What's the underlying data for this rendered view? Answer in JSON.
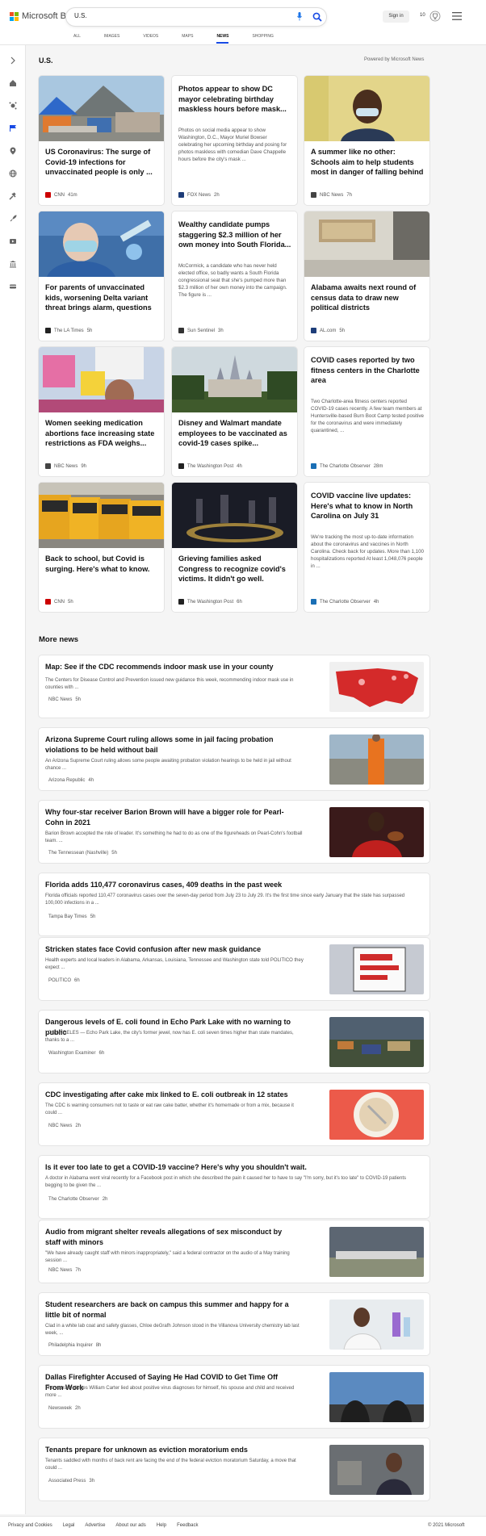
{
  "header": {
    "logo_text": "Microsoft Bing",
    "query": "U.S.",
    "signin_label": "Sign in",
    "rewards_count": "10"
  },
  "tabs": [
    "ALL",
    "IMAGES",
    "VIDEOS",
    "MAPS",
    "NEWS",
    "SHOPPING"
  ],
  "colors": {
    "accent": "#174ae4",
    "ms_red": "#f25022",
    "ms_green": "#7fba00",
    "ms_blue": "#00a4ef",
    "ms_yellow": "#ffb900"
  },
  "section": {
    "title": "U.S.",
    "powered": "Powered by Microsoft News"
  },
  "cards": [
    {
      "title": "US Coronavirus: The surge of Covid-19 infections for unvaccinated people is only ...",
      "source": "CNN",
      "time": "41m",
      "image": "tents-photo"
    },
    {
      "title": "Photos appear to show DC mayor celebrating birthday maskless hours before mask...",
      "snippet": "Photos on social media appear to show Washington, D.C., Mayor Muriel Bowser celebrating her upcoming birthday and posing for photos maskless with comedian Dave Chappelle hours before the city's mask ...",
      "source": "FOX News",
      "time": "2h"
    },
    {
      "title": "A summer like no other: Schools aim to help students most in danger of falling behind",
      "source": "NBC News",
      "time": "7h",
      "image": "student-photo"
    },
    {
      "title": "For parents of unvaccinated kids, worsening Delta variant threat brings alarm, questions",
      "source": "The LA Times",
      "time": "5h",
      "image": "vaccine-photo"
    },
    {
      "title": "Wealthy candidate pumps staggering $2.3 million of her own money into South Florida...",
      "snippet": "McCormick, a candidate who has never held elected office, so badly wants a South Florida congressional seat that she's pumped more than $2.3 million of her own money into the campaign. The figure is ...",
      "source": "Sun Sentinel",
      "time": "3h"
    },
    {
      "title": "Alabama awaits next round of census data to draw new political districts",
      "source": "AL.com",
      "time": "5h",
      "image": "office-photo"
    },
    {
      "title": "Women seeking medication abortions face increasing state restrictions as FDA weighs...",
      "source": "NBC News",
      "time": "9h",
      "image": "protest-photo"
    },
    {
      "title": "Disney and Walmart mandate employees to be vaccinated as covid-19 cases spike...",
      "source": "The Washington Post",
      "time": "4h",
      "image": "castle-photo"
    },
    {
      "title": "COVID cases reported by two fitness centers in the Charlotte area",
      "snippet": "Two Charlotte-area fitness centers reported COVID-19 cases recently. A few team members at Huntersville-based Burn Boot Camp tested positive for the coronavirus and were immediately quarantined, ...",
      "source": "The Charlotte Observer",
      "time": "28m"
    },
    {
      "title": "Back to school, but Covid is surging. Here's what to know.",
      "source": "CNN",
      "time": "5h",
      "image": "buses-photo"
    },
    {
      "title": "Grieving families asked Congress to recognize covid's victims. It didn't go well.",
      "source": "The Washington Post",
      "time": "6h",
      "image": "vigil-photo"
    },
    {
      "title": "COVID vaccine live updates: Here's what to know in North Carolina on July 31",
      "snippet": "We're tracking the most up-to-date information about the coronavirus and vaccines in North Carolina. Check back for updates. More than 1,100 hospitalizations reported At least 1,048,076 people in ...",
      "source": "The Charlotte Observer",
      "time": "4h"
    }
  ],
  "more_title": "More news",
  "more": [
    {
      "title": "Map: See if the CDC recommends indoor mask use in your county",
      "snippet": "The Centers for Disease Control and Prevention issued new guidance this week, recommending indoor mask use in counties with ...",
      "source": "NBC News",
      "time": "5h",
      "image": "us-map"
    },
    {
      "title": "Arizona Supreme Court ruling allows some in jail facing probation violations to be held without bail",
      "snippet": "An Arizona Supreme Court ruling allows some people awaiting probation violation hearings to be held in jail without chance ...",
      "source": "Arizona Republic",
      "time": "4h",
      "image": "inmate-photo"
    },
    {
      "title": "Why four-star receiver Barion Brown will have a bigger role for Pearl-Cohn in 2021",
      "snippet": "Barion Brown accepted the role of leader. It's something he had to do as one of the figureheads on Pearl-Cohn's football team. ...",
      "source": "The Tennessean (Nashville)",
      "time": "5h",
      "image": "football-photo"
    },
    {
      "title": "Florida adds 110,477 coronavirus cases, 409 deaths in the past week",
      "snippet": "Florida officials reported 110,477 coronavirus cases over the seven-day period from July 23 to July 29. It's the first time since early January that the state has surpassed 100,000 infections in a ...",
      "source": "Tampa Bay Times",
      "time": "5h"
    },
    {
      "title": "Stricken states face Covid confusion after new mask guidance",
      "snippet": "Health experts and local leaders in Alabama, Arkansas, Louisiana, Tennessee and Washington state told POLITICO they expect ...",
      "source": "POLITICO",
      "time": "6h",
      "image": "mask-sign"
    },
    {
      "title": "Dangerous levels of E. coli found in Echo Park Lake with no warning to public",
      "snippet": "LOS ANGELES — Echo Park Lake, the city's former jewel, now has E. coli seven times higher than state mandates, thanks to a ...",
      "source": "Washington Examiner",
      "time": "6h",
      "image": "lake-photo"
    },
    {
      "title": "CDC investigating after cake mix linked to E. coli outbreak in 12 states",
      "snippet": "The CDC is warning consumers not to taste or eat raw cake batter, whether it's homemade or from a mix, because it could ...",
      "source": "NBC News",
      "time": "2h",
      "image": "batter-photo"
    },
    {
      "title": "Is it ever too late to get a COVID-19 vaccine? Here's why you shouldn't wait.",
      "snippet": "A doctor in Alabama went viral recently for a Facebook post in which she described the pain it caused her to have to say \"I'm sorry, but it's too late\" to COVID-19 patients begging to be given the ...",
      "source": "The Charlotte Observer",
      "time": "2h"
    },
    {
      "title": "Audio from migrant shelter reveals allegations of sex misconduct by staff with minors",
      "snippet": "\"We have already caught staff with minors inappropriately,\" said a federal contractor on the audio of a May training session ...",
      "source": "NBC News",
      "time": "7h",
      "image": "shelter-photo"
    },
    {
      "title": "Student researchers are back on campus this summer and happy for a little bit of normal",
      "snippet": "Clad in a white lab coat and safety glasses, Chloe deGrafh Johnson stood in the Villanova University chemistry lab last week, ...",
      "source": "Philadelphia Inquirer",
      "time": "8h",
      "image": "lab-photo"
    },
    {
      "title": "Dallas Firefighter Accused of Saying He Had COVID to Get Time Off From Work",
      "snippet": "The warrant alleges William Carter lied about positive virus diagnoses for himself, his spouse and child and received more ...",
      "source": "Newsweek",
      "time": "2h",
      "image": "firefighters-photo"
    },
    {
      "title": "Tenants prepare for unknown as eviction moratorium ends",
      "snippet": "Tenants saddled with months of back rent are facing the end of the federal eviction moratorium Saturday, a move that could ...",
      "source": "Associated Press",
      "time": "3h",
      "image": "tenant-photo"
    }
  ],
  "footer": {
    "links": [
      "Privacy and Cookies",
      "Legal",
      "Advertise",
      "About our ads",
      "Help",
      "Feedback"
    ],
    "copyright": "© 2021 Microsoft"
  }
}
